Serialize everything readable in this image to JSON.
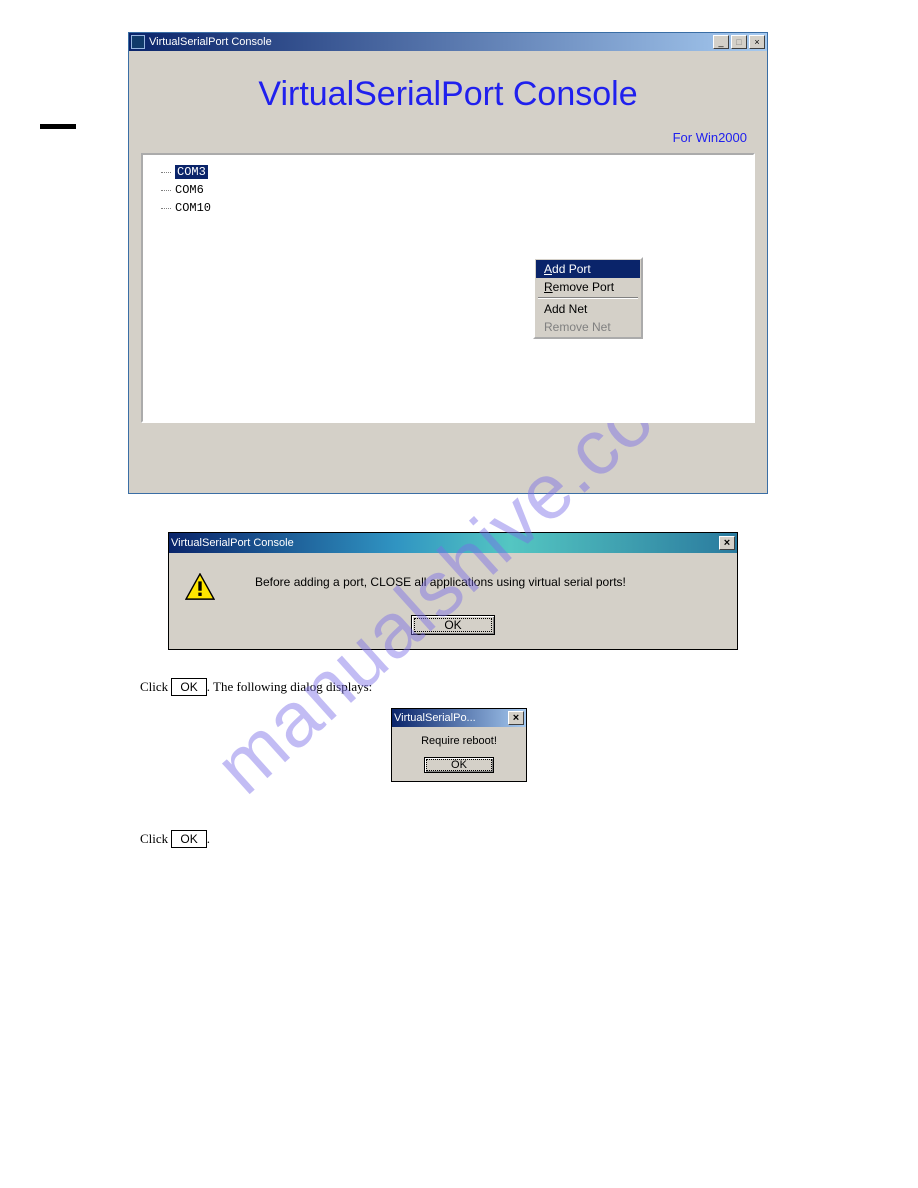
{
  "main_window": {
    "title": "VirtualSerialPort Console",
    "banner_title": "VirtualSerialPort Console",
    "banner_sub": "For Win2000",
    "tree": [
      {
        "label": "COM3",
        "selected": true
      },
      {
        "label": "COM6",
        "selected": false
      },
      {
        "label": "COM10",
        "selected": false
      }
    ],
    "context_menu": {
      "add_port": "Add Port",
      "remove_port": "Remove Port",
      "add_net": "Add Net",
      "remove_net": "Remove Net"
    },
    "sys": {
      "minimize": "_",
      "maximize": "□",
      "close": "×"
    }
  },
  "dialog1": {
    "title": "VirtualSerialPort Console",
    "text": "Before adding a port, CLOSE all applications using virtual serial ports!",
    "ok": "OK",
    "close": "×"
  },
  "body1": {
    "line1_prefix": "Click",
    "line1_btn": "OK",
    "line1_suffix": ".  The following dialog displays:"
  },
  "dialog2": {
    "title": "VirtualSerialPo...",
    "text": "Require reboot!",
    "ok": "OK",
    "close": "×"
  },
  "body2": {
    "line1_prefix": "Click",
    "line1_btn": "OK",
    "line1_suffix": "."
  },
  "watermark": "manualshive.com"
}
